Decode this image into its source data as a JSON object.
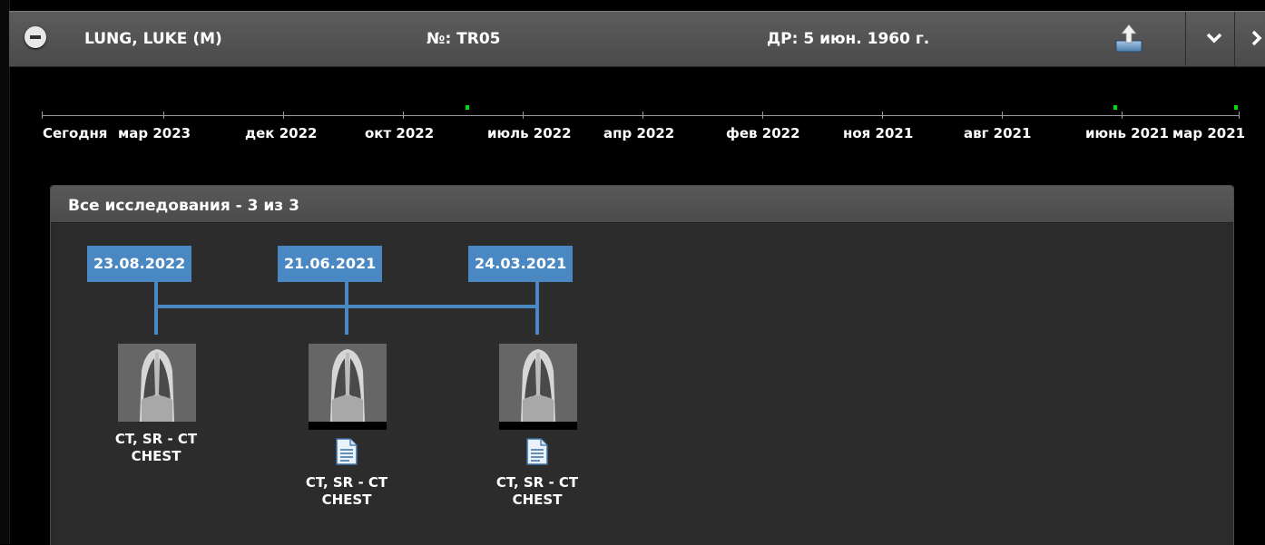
{
  "header": {
    "patient_name": "LUNG, LUKE (M)",
    "patient_id": "№: TR05",
    "birth_date": "ДР: 5 июн. 1960 г.",
    "colors": {
      "bar": "#555555",
      "accent": "#4a88c4",
      "marker": "#00e000"
    }
  },
  "timeline": {
    "labels": [
      "Сегодня",
      "мар 2023",
      "дек 2022",
      "окт 2022",
      "июль 2022",
      "апр 2022",
      "фев 2022",
      "ноя 2021",
      "авг 2021",
      "июнь 2021",
      "мар 2021"
    ]
  },
  "panel": {
    "title": "Все исследования - 3 из 3",
    "studies": [
      {
        "date": "23.08.2022",
        "label_line1": "CT, SR - CT",
        "label_line2": "CHEST",
        "selected": false,
        "has_report": false
      },
      {
        "date": "21.06.2021",
        "label_line1": "CT, SR - CT",
        "label_line2": "CHEST",
        "selected": true,
        "has_report": true
      },
      {
        "date": "24.03.2021",
        "label_line1": "CT, SR - CT",
        "label_line2": "CHEST",
        "selected": true,
        "has_report": true
      }
    ]
  }
}
